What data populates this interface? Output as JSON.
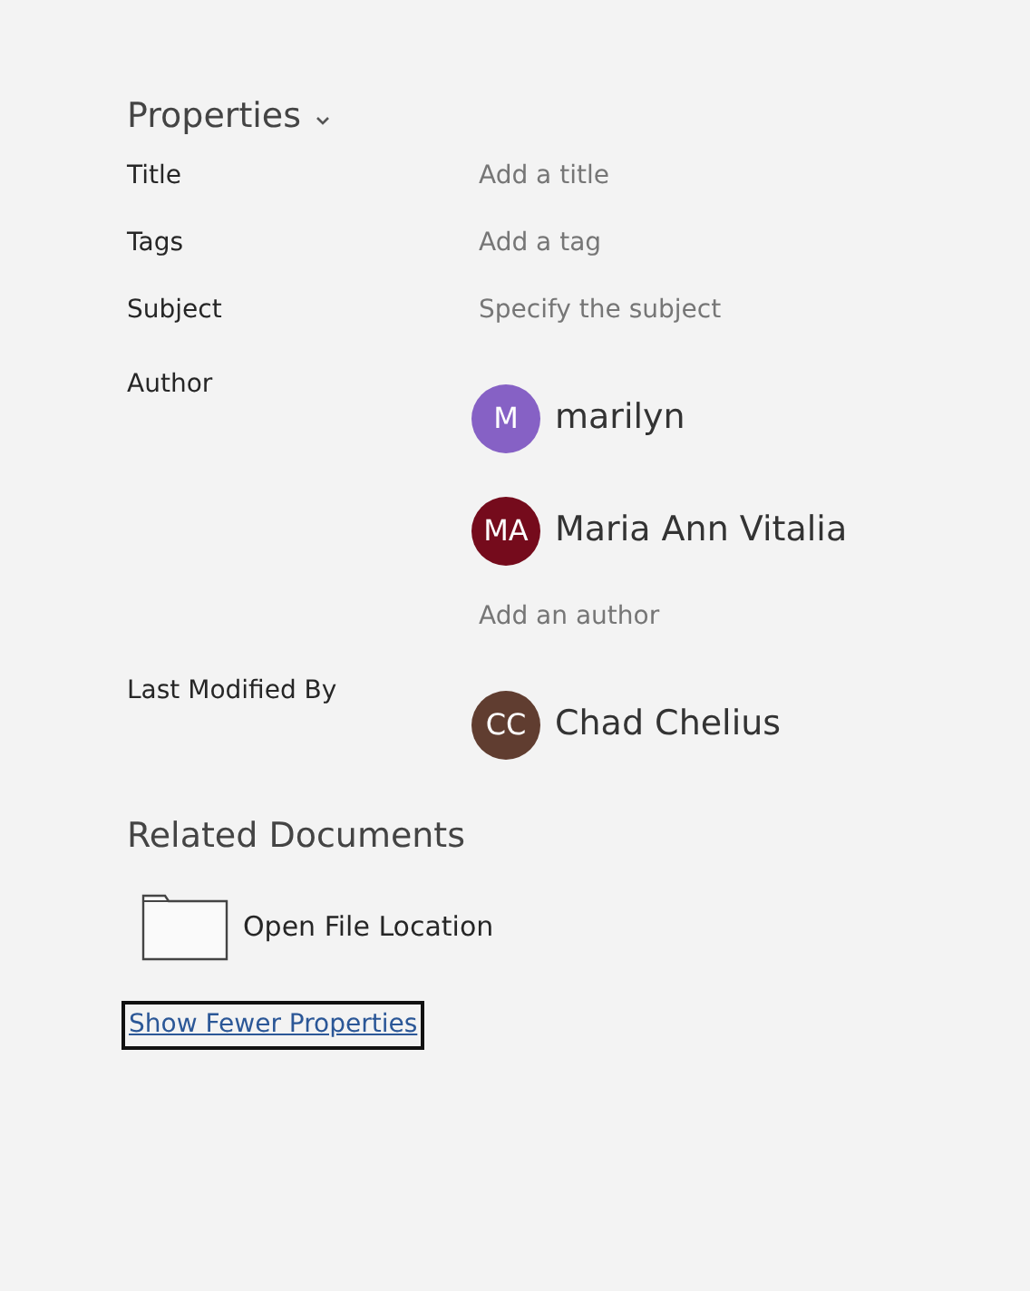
{
  "properties": {
    "heading": "Properties",
    "fields": [
      {
        "label": "Title",
        "kind": "text",
        "placeholder": "Add a title"
      },
      {
        "label": "Tags",
        "kind": "text",
        "placeholder": "Add a tag"
      },
      {
        "label": "Subject",
        "kind": "text",
        "placeholder": "Specify the subject"
      },
      {
        "label": "Author",
        "kind": "people",
        "people": [
          {
            "initials": "M",
            "name": "marilyn",
            "color": "#8661c5"
          },
          {
            "initials": "MA",
            "name": "Maria Ann Vitalia",
            "color": "#750b1c"
          }
        ],
        "add_label": "Add an author"
      },
      {
        "label": "Last Modified By",
        "kind": "people",
        "people": [
          {
            "initials": "CC",
            "name": "Chad Chelius",
            "color": "#603d30"
          }
        ]
      }
    ]
  },
  "related_documents": {
    "heading": "Related Documents",
    "items": [
      {
        "label": "Open File Location"
      }
    ]
  },
  "toggle_link": {
    "label": "Show Fewer Properties",
    "focused": true
  }
}
